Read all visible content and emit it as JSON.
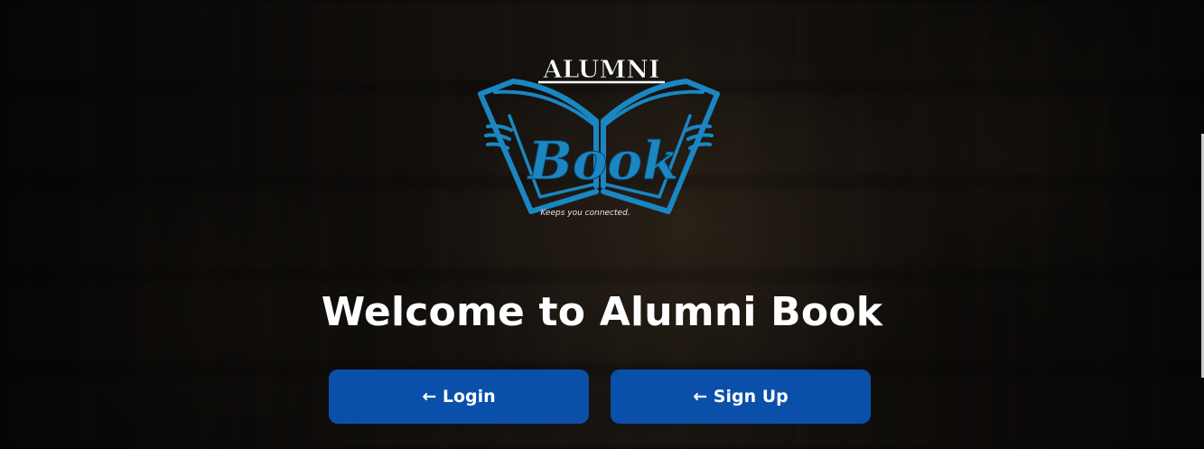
{
  "logo": {
    "wordmark_top": "ALUMNI",
    "wordmark_main": "Book",
    "tagline": "Keeps you connected."
  },
  "hero": {
    "title": "Welcome to Alumni Book"
  },
  "actions": {
    "login_label": "← Login",
    "signup_label": "← Sign Up"
  },
  "colors": {
    "button": "#0a4faa",
    "logo_blue": "#1a86c2",
    "text": "#ffffff"
  }
}
